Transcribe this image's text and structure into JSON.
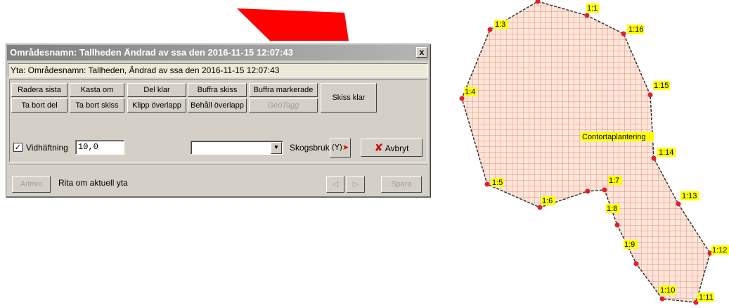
{
  "dialog": {
    "title": "Områdesnamn: Tallheden Ändrad av ssa den 2016-11-15 12:07:43",
    "close": "x",
    "info": "Yta: Områdesnamn: Tallheden, Ändrad av ssa den 2016-11-15 12:07:43",
    "buttons": {
      "radera_sista": "Radera sista",
      "kasta_om": "Kasta om",
      "del_klar": "Del klar",
      "buffra_skiss": "Buffra skiss",
      "buffra_markerade": "Buffra markerade",
      "skiss_klar": "Skiss klar",
      "ta_bort_del": "Ta bort del",
      "ta_bort_skiss": "Ta bort skiss",
      "klipp_overlapp": "Klipp överlapp",
      "behall_overlapp": "Behåll överlapp",
      "geotagg": "GeoTagg",
      "avbryt": "Avbryt",
      "admin": "Admin",
      "spara": "Spara"
    },
    "vidhaftning": {
      "label": "Vidhäftning",
      "checked": true,
      "value": "10,0"
    },
    "dropdown": {
      "value": ""
    },
    "skogsbruk_label": "Skogsbruk",
    "status": "Rita om aktuell yta"
  },
  "map": {
    "polygon_label": "Contortaplantering",
    "vertex_labels": [
      "1:1",
      "1:3",
      "1:16",
      "1:4",
      "1:15",
      "1:14",
      "1:5",
      "1:7",
      "1:6",
      "1:8",
      "1:13",
      "1:9",
      "1:12",
      "1:10",
      "1:11"
    ]
  },
  "colors": {
    "shape_red": "#ff0000",
    "hatch": "#f08a6a",
    "vertex": "#e0202c",
    "label_bg": "#ffff00"
  }
}
